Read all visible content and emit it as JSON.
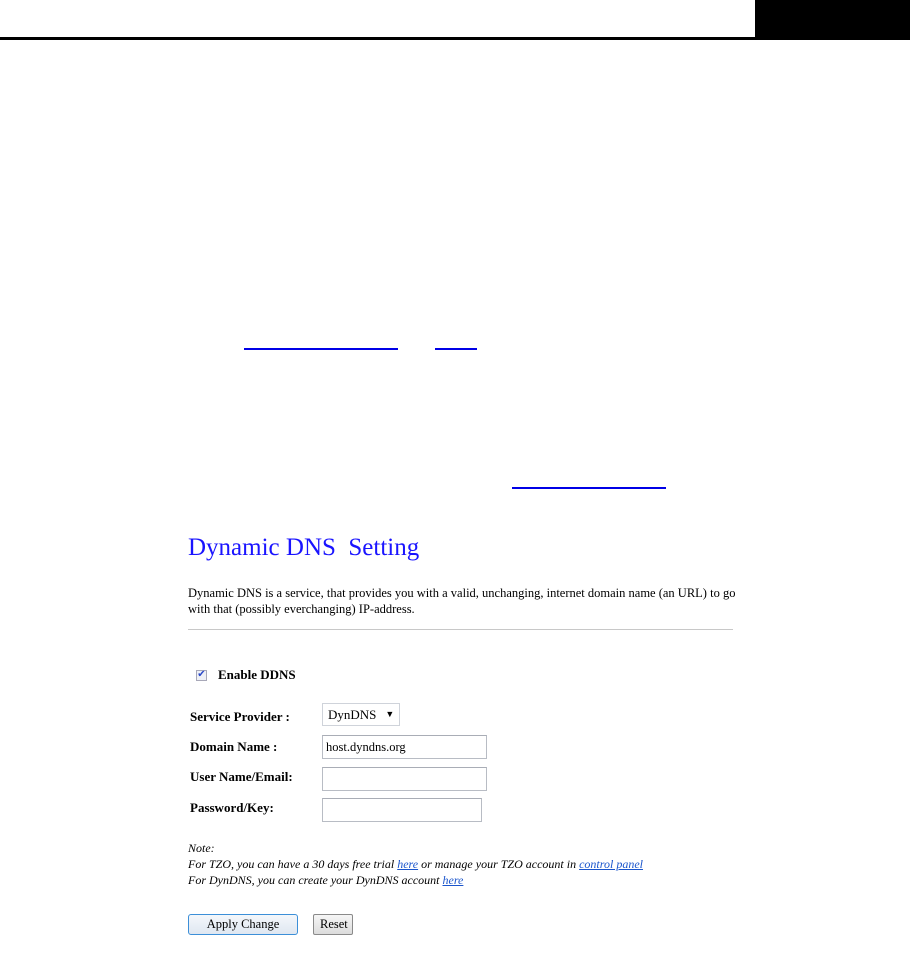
{
  "page": {
    "header_colors": {
      "rule": "#000000",
      "block": "#000000"
    },
    "link_color": "#0000e6"
  },
  "ddns": {
    "title": "Dynamic DNS  Setting",
    "title_color": "#1a14ff",
    "description": "Dynamic DNS is a service, that provides you with a valid, unchanging, internet domain name (an URL) to go with that (possibly everchanging) IP-address.",
    "enable": {
      "label": "Enable DDNS",
      "checked": true
    },
    "fields": {
      "service_provider": {
        "label": "Service Provider :",
        "value": "DynDNS"
      },
      "domain_name": {
        "label": "Domain Name :",
        "value": "host.dyndns.org",
        "placeholder": ""
      },
      "username": {
        "label": "User Name/Email:",
        "value": "",
        "placeholder": ""
      },
      "password": {
        "label": "Password/Key:",
        "value": "",
        "placeholder": ""
      }
    },
    "note": {
      "heading": "Note:",
      "tzo_prefix": "For TZO, you can have a 30 days free trial ",
      "tzo_link1": "here",
      "tzo_middle": " or manage your TZO account in ",
      "tzo_link2": "control panel",
      "dyndns_prefix": "For DynDNS, you can create your DynDNS account ",
      "dyndns_link": "here"
    },
    "buttons": {
      "apply": "Apply Change",
      "reset": "Reset"
    }
  }
}
